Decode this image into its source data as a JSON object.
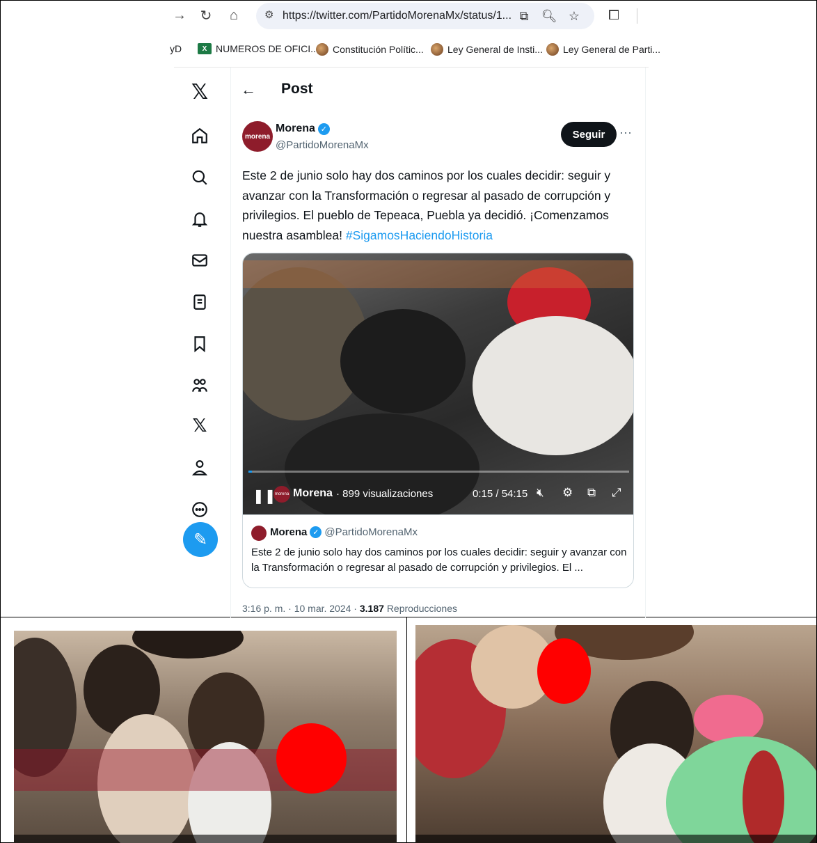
{
  "browser": {
    "url": "https://twitter.com/PartidoMorenaMx/status/1...",
    "bookmarks": [
      {
        "label": "yD",
        "icon": "none"
      },
      {
        "label": "NUMEROS DE OFICI...",
        "icon": "excel-icon"
      },
      {
        "label": "Constitución Polític...",
        "icon": "seal-icon"
      },
      {
        "label": "Ley General de Insti...",
        "icon": "seal-icon"
      },
      {
        "label": "Ley General de Parti...",
        "icon": "seal-icon"
      }
    ]
  },
  "header": {
    "title": "Post"
  },
  "post": {
    "author_name": "Morena",
    "author_handle": "@PartidoMorenaMx",
    "avatar_text": "morena",
    "follow_label": "Seguir",
    "text": "Este 2 de junio solo hay dos caminos por los cuales decidir: seguir y avanzar con la Transformación o regresar al pasado de corrupción y privilegios. El pueblo de Tepeaca, Puebla ya decidió. ¡Comenzamos nuestra asamblea!",
    "hashtag": "#SigamosHaciendoHistoria",
    "timestamp": "3:16 p. m. · 10 mar. 2024 · ",
    "views_count": "3.187",
    "views_label": "Reproducciones"
  },
  "video": {
    "channel": "Morena",
    "views": "· 899 visualizaciones",
    "time": "0:15 / 54:15",
    "progress": 0.005
  },
  "quote": {
    "name": "Morena",
    "handle": "@PartidoMorenaMx",
    "text": "Este 2 de junio solo hay dos caminos por los cuales decidir: seguir y avanzar con la Transformación o regresar al pasado de corrupción y privilegios. El ..."
  },
  "colors": {
    "accent": "#1d9bf0",
    "brand": "#8e1c2b",
    "censor": "#ff0000"
  }
}
